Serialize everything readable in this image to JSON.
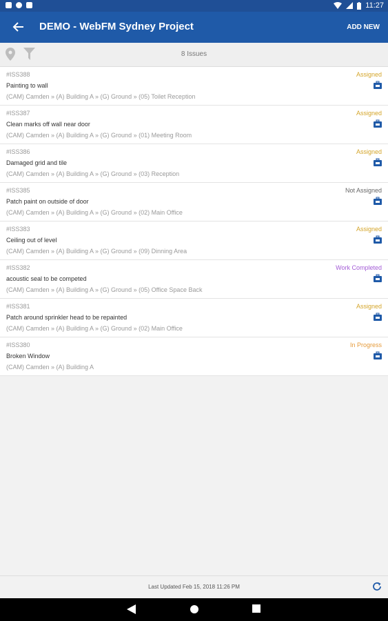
{
  "status_bar": {
    "time": "11:27"
  },
  "app_bar": {
    "title": "DEMO - WebFM Sydney Project",
    "add_new": "ADD NEW"
  },
  "toolbar": {
    "issue_count": "8 Issues"
  },
  "issues": [
    {
      "id": "#ISS388",
      "description": "Painting to wall",
      "location": "(CAM) Camden » (A) Building A » (G) Ground  » (05) Toilet Reception",
      "status": "Assigned",
      "status_color": "#d4a52a"
    },
    {
      "id": "#ISS387",
      "description": "Clean marks off wall near door",
      "location": "(CAM) Camden » (A) Building A » (G) Ground  » (01) Meeting Room",
      "status": "Assigned",
      "status_color": "#d4a52a"
    },
    {
      "id": "#ISS386",
      "description": "Damaged grid and tile",
      "location": "(CAM) Camden » (A) Building A » (G) Ground  » (03) Reception",
      "status": "Assigned",
      "status_color": "#d4a52a"
    },
    {
      "id": "#ISS385",
      "description": "Patch paint on outside of door",
      "location": "(CAM) Camden » (A) Building A » (G) Ground  » (02) Main Office",
      "status": "Not Assigned",
      "status_color": "#666666"
    },
    {
      "id": "#ISS383",
      "description": "Ceiling out of level",
      "location": "(CAM) Camden » (A) Building A » (G) Ground  » (09) Dinning Area",
      "status": "Assigned",
      "status_color": "#d4a52a"
    },
    {
      "id": "#ISS382",
      "description": "acoustic seal to be competed",
      "location": "(CAM) Camden » (A) Building A » (G) Ground  » (05) Office Space Back",
      "status": "Work Completed",
      "status_color": "#a35bd6"
    },
    {
      "id": "#ISS381",
      "description": "Patch around sprinkler head to be repainted",
      "location": "(CAM) Camden » (A) Building A » (G) Ground  » (02) Main Office",
      "status": "Assigned",
      "status_color": "#d4a52a"
    },
    {
      "id": "#ISS380",
      "description": "Broken Window",
      "location": "(CAM) Camden » (A) Building A",
      "status": "In Progress",
      "status_color": "#e59a3a"
    }
  ],
  "footer": {
    "last_updated": "Last Updated Feb 15, 2018 11:26 PM"
  },
  "colors": {
    "app_bar": "#1f5aa8",
    "status_bar": "#1f4f96",
    "icon_blue": "#1f5aa8"
  }
}
